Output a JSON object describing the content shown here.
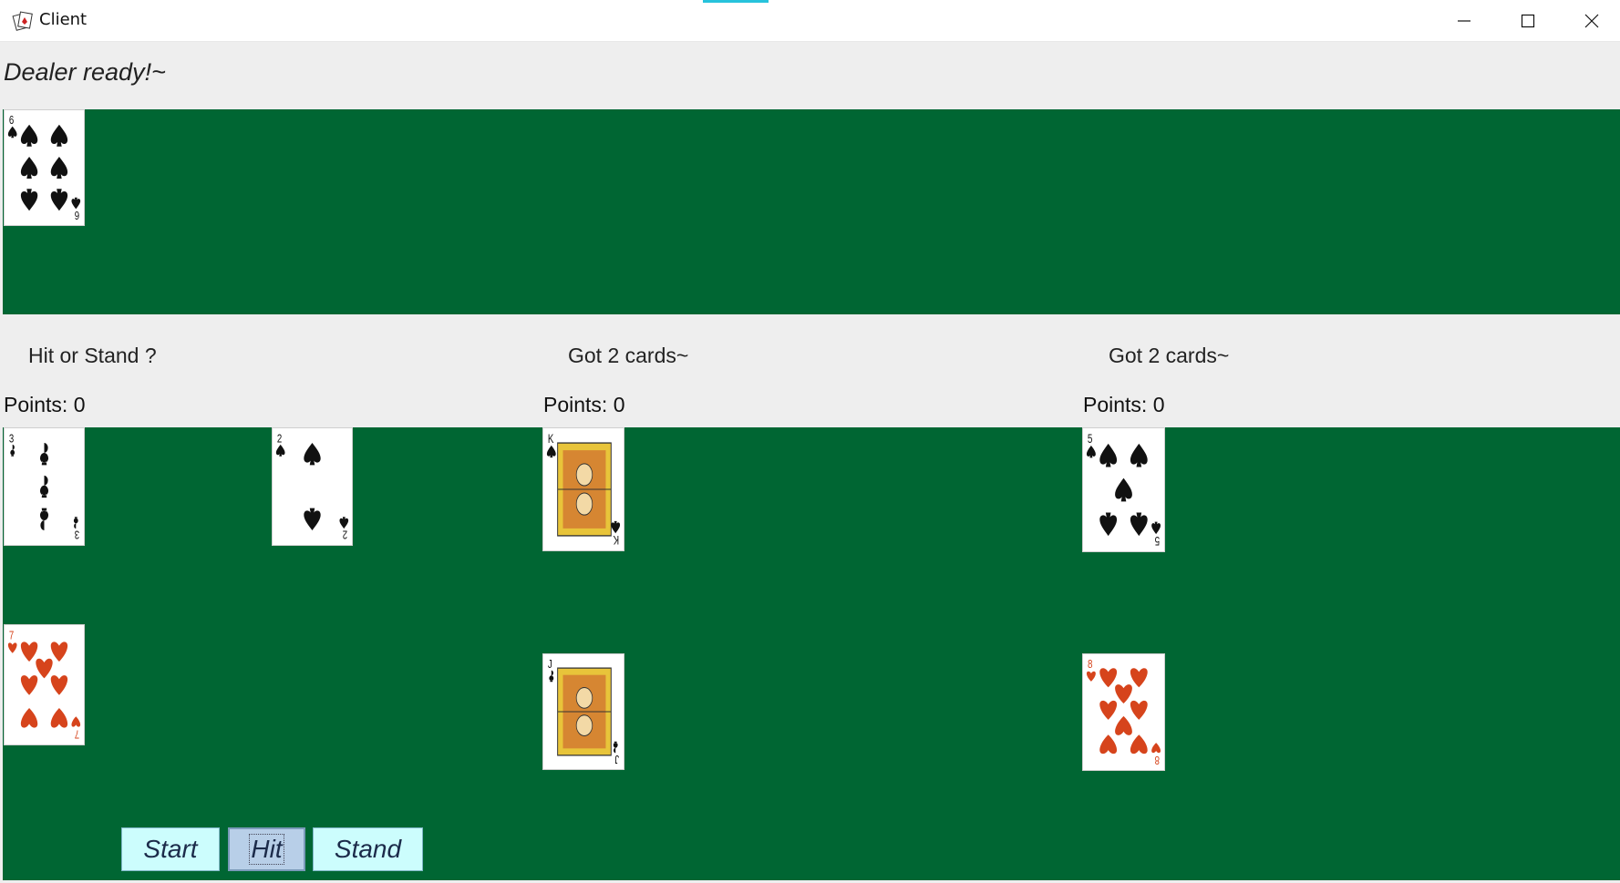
{
  "window": {
    "title": "Client"
  },
  "dealer": {
    "status": "Dealer ready!~",
    "cards": [
      {
        "rank": "6",
        "suit": "spades",
        "color": "#111111"
      }
    ]
  },
  "players": [
    {
      "message": "Hit or Stand ?",
      "points_label": "Points: 0",
      "cards": [
        {
          "rank": "3",
          "suit": "clubs",
          "color": "#111111"
        },
        {
          "rank": "2",
          "suit": "spades",
          "color": "#111111"
        },
        {
          "rank": "7",
          "suit": "hearts",
          "color": "#d6441c"
        }
      ]
    },
    {
      "message": "Got 2 cards~",
      "points_label": "Points: 0",
      "cards": [
        {
          "rank": "K",
          "suit": "spades",
          "color": "#111111"
        },
        {
          "rank": "J",
          "suit": "clubs",
          "color": "#111111"
        }
      ]
    },
    {
      "message": "Got 2 cards~",
      "points_label": "Points: 0",
      "cards": [
        {
          "rank": "5",
          "suit": "spades",
          "color": "#111111"
        },
        {
          "rank": "8",
          "suit": "hearts",
          "color": "#d6441c"
        }
      ]
    }
  ],
  "controls": {
    "start_label": "Start",
    "hit_label": "Hit",
    "stand_label": "Stand"
  },
  "colors": {
    "table_green": "#006633",
    "button_bg": "#ccfdfd",
    "button_pressed_bg": "#b8cfe8",
    "red_suit": "#d6441c"
  }
}
